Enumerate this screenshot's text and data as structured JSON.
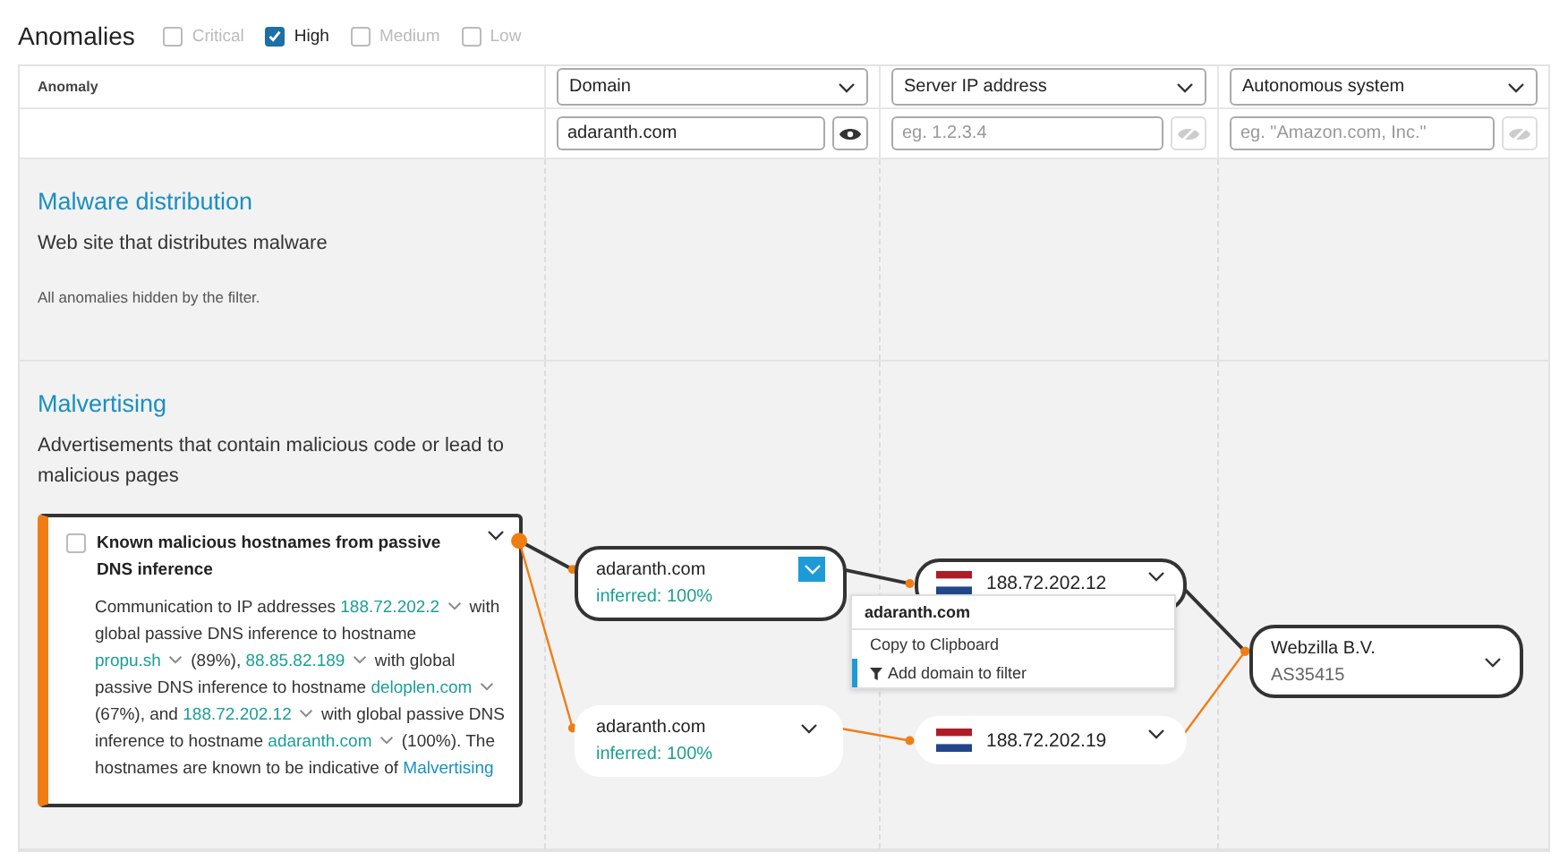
{
  "title": "Anomalies",
  "severity_filters": [
    {
      "label": "Critical",
      "checked": false
    },
    {
      "label": "High",
      "checked": true
    },
    {
      "label": "Medium",
      "checked": false
    },
    {
      "label": "Low",
      "checked": false
    }
  ],
  "table": {
    "columns": [
      {
        "kind": "text",
        "label": "Anomaly"
      },
      {
        "kind": "select",
        "label": "Domain"
      },
      {
        "kind": "select",
        "label": "Server IP address"
      },
      {
        "kind": "select",
        "label": "Autonomous system"
      }
    ],
    "filters": [
      {
        "value": "adaranth.com",
        "visible": true
      },
      {
        "placeholder": "eg. 1.2.3.4",
        "visible": false
      },
      {
        "placeholder": "eg. \"Amazon.com, Inc.\"",
        "visible": false
      }
    ]
  },
  "sections": [
    {
      "title": "Malware distribution",
      "description": "Web site that distributes malware",
      "note": "All anomalies hidden by the filter."
    },
    {
      "title": "Malvertising",
      "description": "Advertisements that contain malicious code or lead to malicious pages",
      "finding": {
        "title": "Known malicious hostnames from passive DNS inference",
        "checked": false,
        "segments": [
          {
            "kind": "text",
            "text": "Communication to IP addresses "
          },
          {
            "kind": "menu_link",
            "text": "188.72.202.2"
          },
          {
            "kind": "text",
            "text": " with global passive DNS inference to hostname "
          },
          {
            "kind": "menu_link",
            "text": "propu.sh"
          },
          {
            "kind": "text",
            "text": " (89%), "
          },
          {
            "kind": "menu_link",
            "text": "88.85.82.189"
          },
          {
            "kind": "text",
            "text": " with global passive DNS inference to hostname "
          },
          {
            "kind": "menu_link",
            "text": "deloplen.com"
          },
          {
            "kind": "text",
            "text": " (67%), and "
          },
          {
            "kind": "menu_link",
            "text": "188.72.202.12"
          },
          {
            "kind": "text",
            "text": " with global passive DNS inference to hostname "
          },
          {
            "kind": "menu_link",
            "text": "adaranth.com"
          },
          {
            "kind": "text",
            "text": " (100%). The hostnames are known to be indicative of "
          },
          {
            "kind": "link",
            "text": "Malvertising"
          }
        ]
      },
      "graph": {
        "domains": [
          {
            "label": "adaranth.com",
            "sub": "inferred: 100%",
            "highlighted": true,
            "menu_open": true
          },
          {
            "label": "adaranth.com",
            "sub": "inferred: 100%",
            "highlighted": false,
            "menu_open": false
          }
        ],
        "ips": [
          {
            "label": "188.72.202.12",
            "highlighted": true
          },
          {
            "label": "188.72.202.19",
            "highlighted": false
          }
        ],
        "systems": [
          {
            "label": "Webzilla B.V.",
            "sub": "AS35415",
            "highlighted": true
          }
        ],
        "menu": {
          "title": "adaranth.com",
          "items": [
            {
              "label": "Copy to Clipboard",
              "selected": false
            },
            {
              "label": "Add domain to filter",
              "selected": true
            }
          ]
        }
      }
    }
  ]
}
